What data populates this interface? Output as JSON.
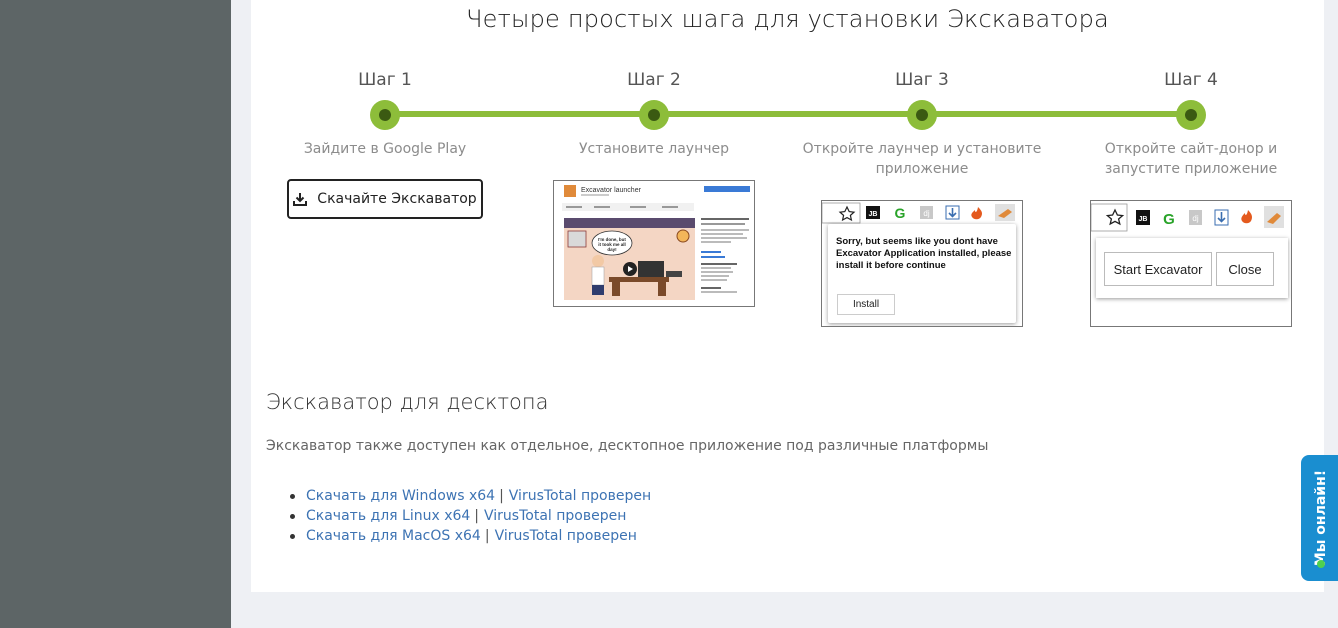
{
  "title": "Четыре простых шага для установки Экскаватора",
  "steps": [
    {
      "label": "Шаг 1",
      "desc": "Зайдите в Google Play"
    },
    {
      "label": "Шаг 2",
      "desc": "Установите лаунчер"
    },
    {
      "label": "Шаг 3",
      "desc": "Откройте лаунчер и установите приложение"
    },
    {
      "label": "Шаг 4",
      "desc": "Откройте сайт-донор и запустите приложение"
    }
  ],
  "download_button": "Скачайте Экскаватор",
  "launcher_shot": {
    "app_name": "Excavator launcher",
    "speech": "I'm done, but it took me all day!"
  },
  "install_popup": {
    "message": "Sorry, but seems like you dont have Excavator Application installed, please install it before continue",
    "install_label": "Install"
  },
  "start_popup": {
    "start_label": "Start Excavator",
    "close_label": "Close"
  },
  "toolbar_icons": {
    "jb": "JB",
    "g": "G",
    "dj": "dj"
  },
  "desktop": {
    "title": "Экскаватор для десктопа",
    "desc": "Экскаватор также доступен как отдельное, десктопное приложение под различные платформы",
    "links": [
      {
        "download": "Скачать для Windows x64",
        "check": "VirusTotal проверен"
      },
      {
        "download": "Скачать для Linux x64",
        "check": "VirusTotal проверен"
      },
      {
        "download": "Скачать для MacOS x64",
        "check": "VirusTotal проверен"
      }
    ]
  },
  "online_badge": "Мы онлайн!",
  "colors": {
    "accent": "#8dbd3a",
    "link": "#3d73b3",
    "badge": "#1a8ed0"
  }
}
